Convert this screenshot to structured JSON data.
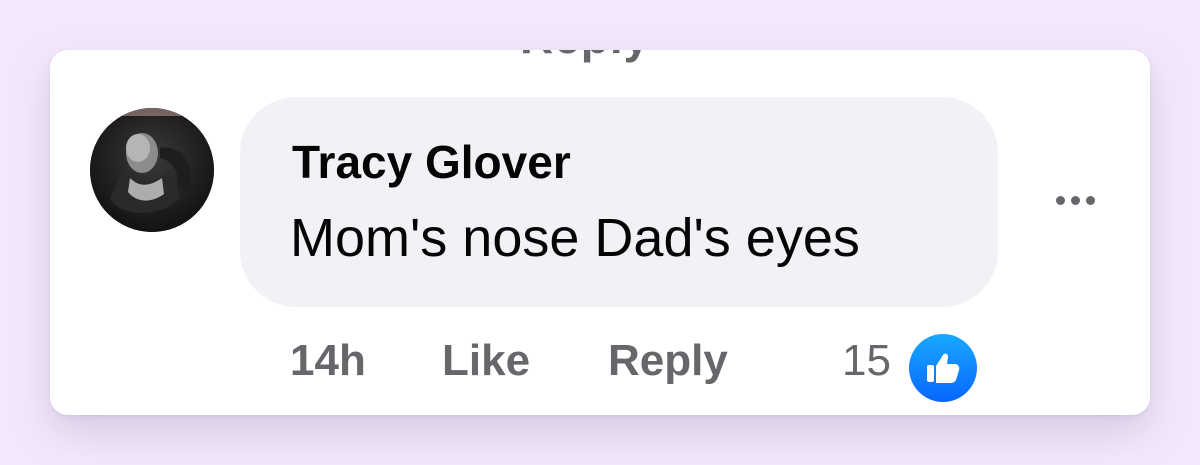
{
  "comment": {
    "author": "Tracy Glover",
    "text": "Mom's nose Dad's eyes",
    "timestamp": "14h",
    "like_label": "Like",
    "reply_label": "Reply",
    "reaction_count": "15",
    "reaction_type": "like-icon"
  },
  "partial_top_text": "Reply",
  "colors": {
    "background": "#f3e8fb",
    "bubble": "#f0f2f5",
    "secondary_text": "#65676b",
    "like_blue": "#0866ff"
  },
  "icons": {
    "more": "more-horizontal-icon",
    "reaction": "thumbs-up-icon"
  }
}
